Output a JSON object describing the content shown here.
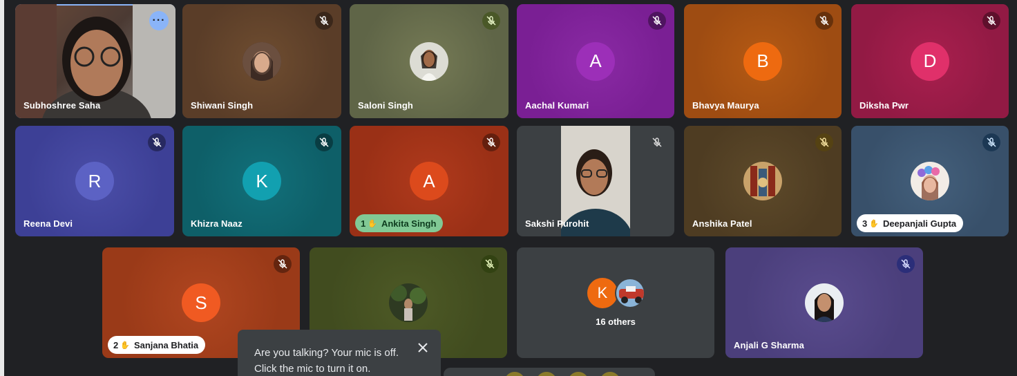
{
  "participants": {
    "p1": {
      "name": "Subhoshree Saha"
    },
    "p2": {
      "name": "Shiwani Singh"
    },
    "p3": {
      "name": "Saloni Singh"
    },
    "p4": {
      "name": "Aachal Kumari",
      "initial": "A"
    },
    "p5": {
      "name": "Bhavya Maurya",
      "initial": "B"
    },
    "p6": {
      "name": "Diksha Pwr",
      "initial": "D"
    },
    "p7": {
      "name": "Reena Devi",
      "initial": "R"
    },
    "p8": {
      "name": "Khizra Naaz",
      "initial": "K"
    },
    "p9": {
      "name": "Ankita Singh",
      "initial": "A",
      "hand_order": "1"
    },
    "p10": {
      "name": "Sakshi Purohit"
    },
    "p11": {
      "name": "Anshika Patel"
    },
    "p12": {
      "name": "Deepanjali Gupta",
      "hand_order": "3"
    },
    "p13": {
      "name": "Sanjana Bhatia",
      "initial": "S",
      "hand_order": "2"
    },
    "p14": {
      "name": ""
    },
    "others": {
      "label": "16 others",
      "initial": "K"
    },
    "p15": {
      "name": "Anjali G Sharma"
    }
  },
  "toast": {
    "message": "Are you talking? Your mic is off. Click the mic to turn it on."
  },
  "icons": {
    "muted": "mic-off-icon",
    "more": "more-options-icon",
    "hand": "raised-hand-icon",
    "close": "close-icon"
  },
  "colors": {
    "accent_blue": "#8ab4f8",
    "hand_green": "#81c995",
    "stage_bg": "#202124"
  }
}
